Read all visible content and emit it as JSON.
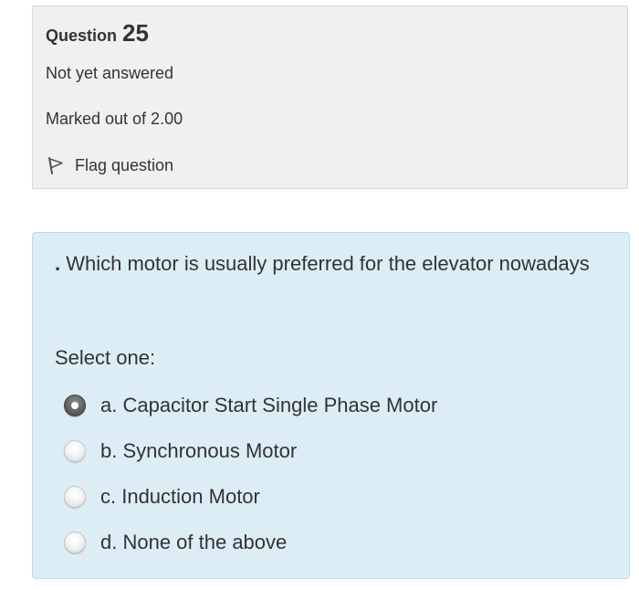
{
  "question_info": {
    "question_word": "Question",
    "question_number": "25",
    "state": "Not yet answered",
    "grade": "Marked out of 2.00",
    "flag_label": "Flag question",
    "flag_icon": "flag-icon"
  },
  "question": {
    "lead": ".",
    "text": " Which motor is usually preferred for the elevator nowadays",
    "prompt": "Select one:",
    "options": [
      {
        "label": "a. Capacitor Start Single Phase Motor",
        "selected": true
      },
      {
        "label": "b. Synchronous Motor",
        "selected": false
      },
      {
        "label": "c. Induction Motor",
        "selected": false
      },
      {
        "label": "d. None of the above",
        "selected": false
      }
    ]
  },
  "colors": {
    "info_background": "#f0f0f0",
    "content_background": "#dcedf6",
    "content_border": "#b8dcec",
    "text": "#333333"
  }
}
